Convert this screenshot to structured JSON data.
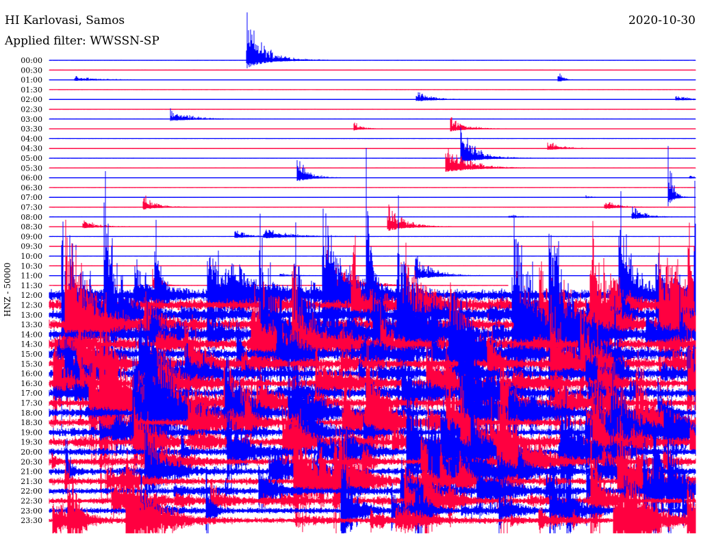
{
  "header": {
    "station": "HI Karlovasi, Samos",
    "filter": "Applied filter: WWSSN-SP",
    "date": "2020-10-30"
  },
  "chart_data": {
    "type": "line",
    "title": "HI Karlovasi, Samos",
    "subtitle": "Applied filter: WWSSN-SP",
    "date": "2020-10-30",
    "ylabel": "HNZ - 50000",
    "xlabel": "",
    "row_labels": [
      "00:00",
      "00:30",
      "01:00",
      "01:30",
      "02:00",
      "02:30",
      "03:00",
      "03:30",
      "04:00",
      "04:30",
      "05:00",
      "05:30",
      "06:00",
      "06:30",
      "07:00",
      "07:30",
      "08:00",
      "08:30",
      "09:00",
      "09:30",
      "10:00",
      "10:30",
      "11:00",
      "11:30",
      "12:00",
      "12:30",
      "13:00",
      "13:30",
      "14:00",
      "14:30",
      "15:00",
      "15:30",
      "16:00",
      "16:30",
      "17:00",
      "17:30",
      "18:00",
      "18:30",
      "19:00",
      "19:30",
      "20:00",
      "20:30",
      "21:00",
      "21:30",
      "22:00",
      "22:30",
      "23:00",
      "23:30"
    ],
    "row_colors": [
      "#0000ff",
      "#ff0040"
    ],
    "row_minutes": 30,
    "mainshock_row": "11:30",
    "mainshock_fraction_of_row": 0.71
  }
}
